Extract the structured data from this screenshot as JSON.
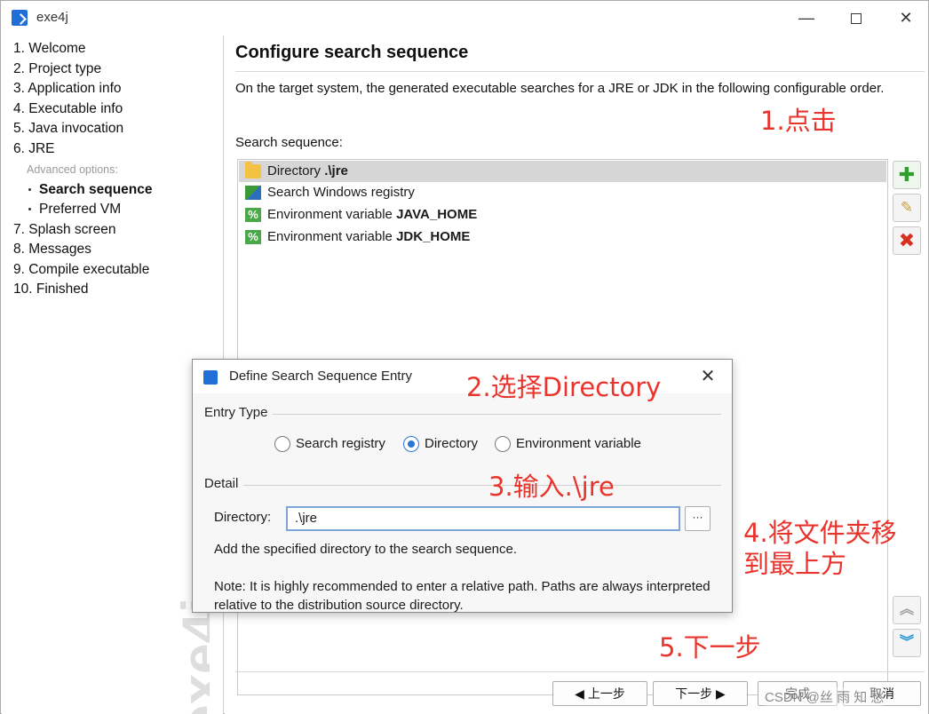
{
  "window": {
    "title": "exe4j",
    "minimize": "—",
    "close": "✕"
  },
  "nav": {
    "items": [
      {
        "label": "1. Welcome"
      },
      {
        "label": "2. Project type"
      },
      {
        "label": "3. Application info"
      },
      {
        "label": "4. Executable info"
      },
      {
        "label": "5. Java invocation"
      },
      {
        "label": "6. JRE"
      }
    ],
    "advanced_header": "Advanced options:",
    "sub_items": [
      {
        "label": "Search sequence",
        "active": true
      },
      {
        "label": "Preferred VM",
        "active": false
      }
    ],
    "items_after": [
      {
        "label": "7. Splash screen"
      },
      {
        "label": "8. Messages"
      },
      {
        "label": "9. Compile executable"
      },
      {
        "label": "10. Finished"
      }
    ],
    "watermark": "exe4j"
  },
  "main": {
    "title": "Configure search sequence",
    "description": "On the target system, the generated executable searches for a JRE or JDK in the following configurable order.",
    "sequence_label": "Search sequence:",
    "sequence": [
      {
        "prefix": "Directory",
        "value": ".\\jre",
        "icon": "folder-icon",
        "selected": true
      },
      {
        "prefix": "Search Windows registry",
        "value": "",
        "icon": "registry-icon",
        "selected": false
      },
      {
        "prefix": "Environment variable",
        "value": "JAVA_HOME",
        "icon": "env-var-icon",
        "selected": false
      },
      {
        "prefix": "Environment variable",
        "value": "JDK_HOME",
        "icon": "env-var-icon",
        "selected": false
      }
    ],
    "side_buttons": {
      "add": "✚",
      "edit": "✎",
      "remove": "✖",
      "up": "︽",
      "down": "︾"
    },
    "buttons": {
      "back": "◀  上一步",
      "next": "下一步  ▶",
      "finish": "完成",
      "cancel": "取消"
    },
    "watermark_credit": "CSDN @丝 雨 知 愁"
  },
  "dialog": {
    "title": "Define Search Sequence Entry",
    "close": "✕",
    "entry_type_label": "Entry Type",
    "radios": [
      {
        "label": "Search registry",
        "checked": false
      },
      {
        "label": "Directory",
        "checked": true
      },
      {
        "label": "Environment variable",
        "checked": false
      }
    ],
    "detail_label": "Detail",
    "directory_label": "Directory:",
    "directory_value": ".\\jre",
    "browse": "···",
    "help_text": "Add the specified directory to the search sequence.",
    "note_text": "Note: It is highly recommended to enter a relative path. Paths are always interpreted relative to the distribution source directory."
  },
  "annotations": {
    "a1": "1.点击",
    "a2": "2.选择Directory",
    "a3": "3.输入.\\jre",
    "a4_line1": "4.将文件夹移",
    "a4_line2": "到最上方",
    "a5": "5.下一步"
  },
  "colors": {
    "annotation": "#e8342c",
    "selection": "#d6d6d6",
    "accent": "#2a76d2"
  }
}
